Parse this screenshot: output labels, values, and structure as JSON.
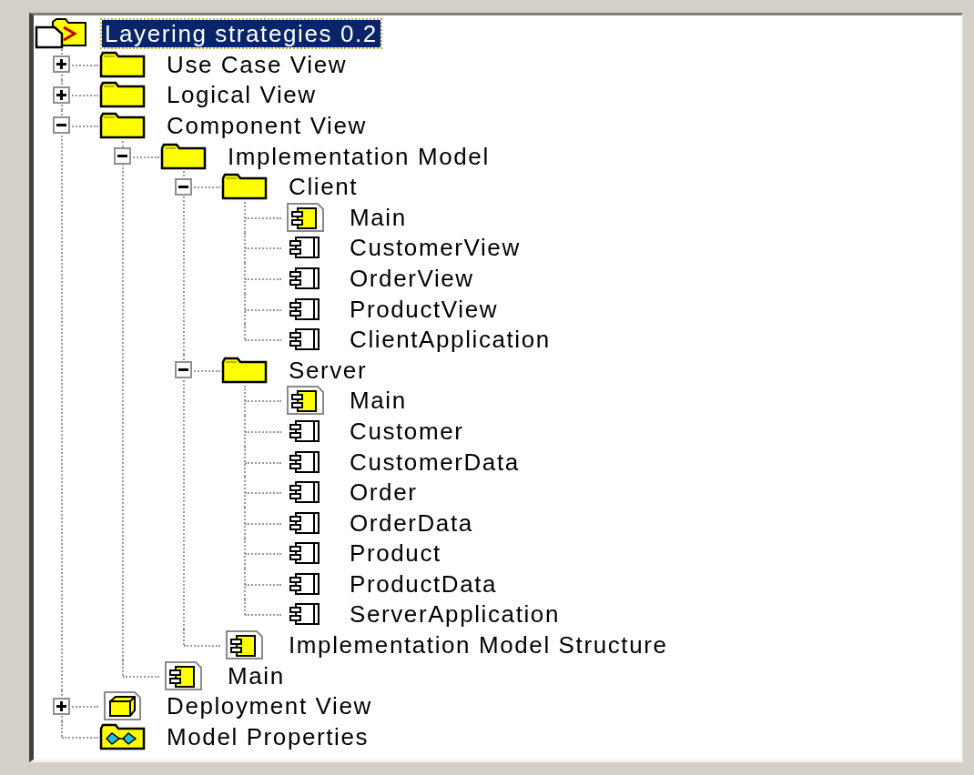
{
  "tree": {
    "label": "Layering strategies 0.2",
    "kind": "model",
    "selected": true,
    "children": [
      {
        "label": "Use Case View",
        "kind": "folder",
        "selected": false,
        "expanded": false
      },
      {
        "label": "Logical View",
        "kind": "folder",
        "selected": false,
        "expanded": false
      },
      {
        "label": "Component View",
        "kind": "folder",
        "selected": false,
        "expanded": true,
        "children": [
          {
            "label": "Implementation Model",
            "kind": "folder",
            "selected": false,
            "expanded": true,
            "children": [
              {
                "label": "Client",
                "kind": "folder",
                "selected": false,
                "expanded": true,
                "children": [
                  {
                    "label": "Main",
                    "kind": "main",
                    "selected": false
                  },
                  {
                    "label": "CustomerView",
                    "kind": "component",
                    "selected": false
                  },
                  {
                    "label": "OrderView",
                    "kind": "component",
                    "selected": false
                  },
                  {
                    "label": "ProductView",
                    "kind": "component",
                    "selected": false
                  },
                  {
                    "label": "ClientApplication",
                    "kind": "component",
                    "selected": false
                  }
                ]
              },
              {
                "label": "Server",
                "kind": "folder",
                "selected": false,
                "expanded": true,
                "children": [
                  {
                    "label": "Main",
                    "kind": "main",
                    "selected": false
                  },
                  {
                    "label": "Customer",
                    "kind": "component",
                    "selected": false
                  },
                  {
                    "label": "CustomerData",
                    "kind": "component",
                    "selected": false
                  },
                  {
                    "label": "Order",
                    "kind": "component",
                    "selected": false
                  },
                  {
                    "label": "OrderData",
                    "kind": "component",
                    "selected": false
                  },
                  {
                    "label": "Product",
                    "kind": "component",
                    "selected": false
                  },
                  {
                    "label": "ProductData",
                    "kind": "component",
                    "selected": false
                  },
                  {
                    "label": "ServerApplication",
                    "kind": "component",
                    "selected": false
                  }
                ]
              },
              {
                "label": "Implementation Model Structure",
                "kind": "main",
                "selected": false
              }
            ]
          },
          {
            "label": "Main",
            "kind": "main",
            "selected": false
          }
        ]
      },
      {
        "label": "Deployment View",
        "kind": "deployment",
        "selected": false,
        "expanded": false
      },
      {
        "label": "Model Properties",
        "kind": "properties",
        "selected": false
      }
    ]
  }
}
